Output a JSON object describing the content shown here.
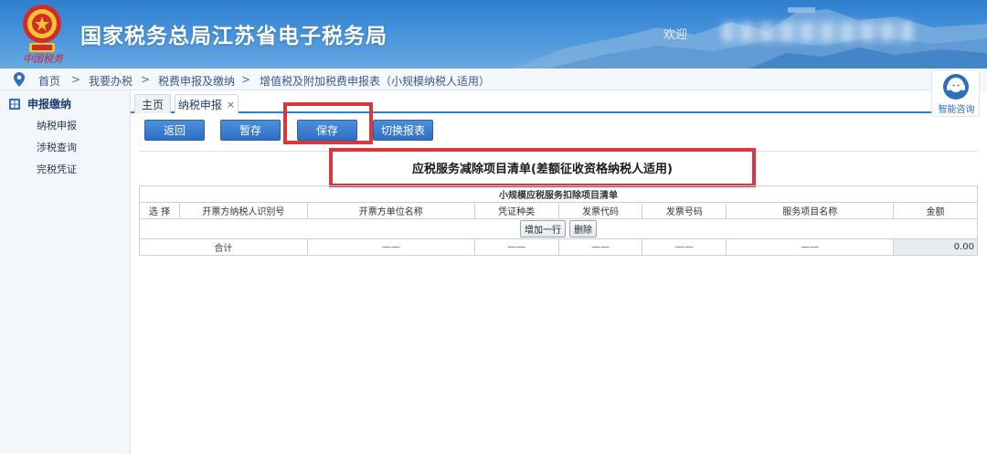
{
  "header": {
    "site_title": "国家税务总局江苏省电子税务局",
    "welcome": "欢迎",
    "colors": {
      "banner_top": "#2f7fd0",
      "banner_bottom": "#6aa9e2",
      "accent": "#2f7fd0",
      "highlight": "#d9363e"
    }
  },
  "breadcrumb": {
    "items": [
      "首页",
      "我要办税",
      "税费申报及缴纳",
      "增值税及附加税费申报表（小规模纳税人适用）"
    ],
    "separator": ">"
  },
  "help": {
    "label": "智能咨询",
    "icon": "headset-icon"
  },
  "sidebar": {
    "header": "申报缴纳",
    "items": [
      {
        "label": "纳税申报"
      },
      {
        "label": "涉税查询"
      },
      {
        "label": "完税凭证"
      }
    ]
  },
  "tabs": [
    {
      "label": "主页",
      "closable": false,
      "active": false
    },
    {
      "label": "纳税申报",
      "closable": true,
      "close_symbol": "×",
      "active": true
    }
  ],
  "toolbar": {
    "back_label": "返回",
    "temp_save_label": "暂存",
    "save_label": "保存",
    "switch_label": "切换报表"
  },
  "report": {
    "title": "应税服务减除项目清单(差额征收资格纳税人适用)",
    "table_caption": "小规模应税服务扣除项目清单",
    "columns": [
      "选 择",
      "开票方纳税人识别号",
      "开票方单位名称",
      "凭证种类",
      "发票代码",
      "发票号码",
      "服务项目名称",
      "金额"
    ],
    "add_row_label": "增加一行",
    "delete_label": "删除",
    "total_row": {
      "label": "合计",
      "placeholders": [
        "——",
        "——",
        "——",
        "——",
        "——"
      ],
      "amount": "0.00"
    }
  }
}
